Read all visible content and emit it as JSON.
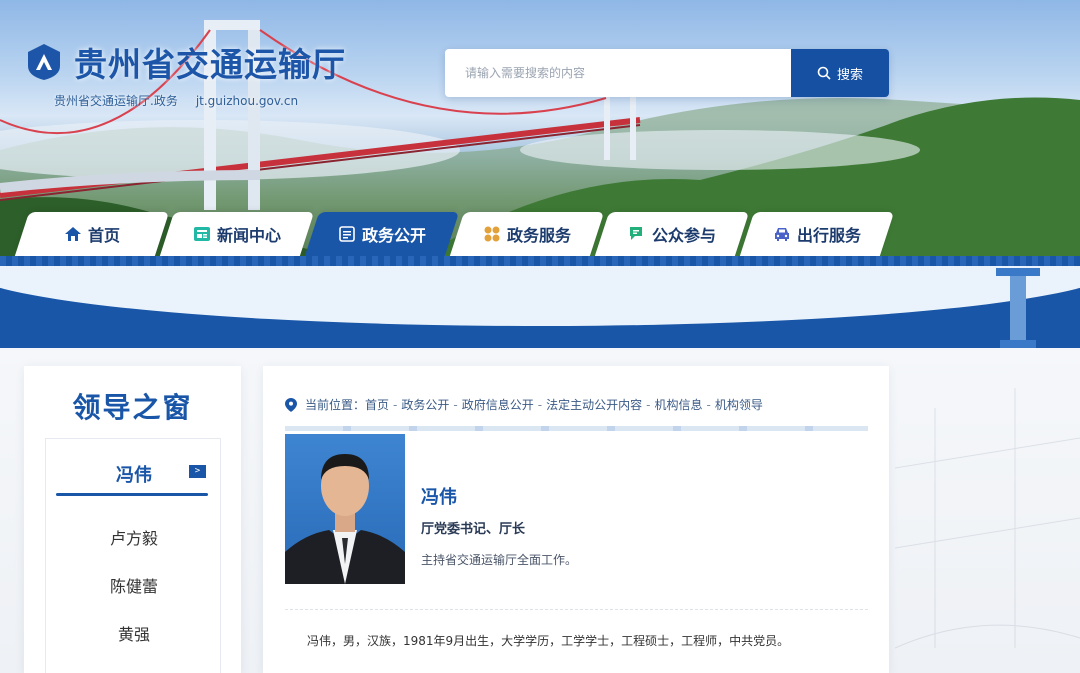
{
  "site": {
    "title": "贵州省交通运输厅",
    "subtitle": "贵州省交通运输厅.政务",
    "domain": "jt.guizhou.gov.cn"
  },
  "search": {
    "placeholder": "请输入需要搜索的内容",
    "button_label": "搜索"
  },
  "nav": {
    "items": [
      {
        "label": "首页",
        "icon": "home-icon"
      },
      {
        "label": "新闻中心",
        "icon": "news-icon"
      },
      {
        "label": "政务公开",
        "icon": "document-icon",
        "active": true
      },
      {
        "label": "政务服务",
        "icon": "grid-icon"
      },
      {
        "label": "公众参与",
        "icon": "chat-icon"
      },
      {
        "label": "出行服务",
        "icon": "car-icon"
      }
    ]
  },
  "sidebar": {
    "title": "领导之窗",
    "arrow": ">",
    "leaders": [
      {
        "name": "冯伟",
        "active": true
      },
      {
        "name": "卢方毅"
      },
      {
        "name": "陈健蕾"
      },
      {
        "name": "黄强"
      }
    ]
  },
  "breadcrumb": {
    "prefix": "当前位置：",
    "separator": "-",
    "items": [
      "首页",
      "政务公开",
      "政府信息公开",
      "法定主动公开内容",
      "机构信息",
      "机构领导"
    ]
  },
  "profile": {
    "name": "冯伟",
    "title": "厅党委书记、厅长",
    "duty": "主持省交通运输厅全面工作。",
    "bio": "冯伟，男，汉族，1981年9月出生，大学学历，工学学士，工程硕士，工程师，中共党员。"
  },
  "colors": {
    "primary": "#1a56a8",
    "search_button": "#1550a3",
    "text_dark": "#333333"
  }
}
